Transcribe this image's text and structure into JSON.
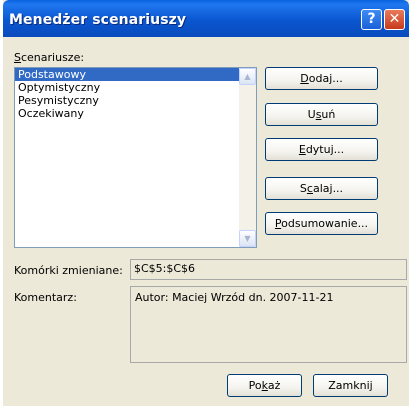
{
  "window": {
    "title": "Menedżer scenariuszy",
    "help_icon_glyph": "?",
    "close_icon_glyph": "✕"
  },
  "scenarios": {
    "label_key": "S",
    "label_rest": "cenariusze:",
    "items": [
      "Podstawowy",
      "Optymistyczny",
      "Pesymistyczny",
      "Oczekiwany"
    ],
    "selected_index": 0
  },
  "buttons": {
    "add": {
      "key": "D",
      "rest": "odaj..."
    },
    "delete": {
      "pre": "U",
      "key": "s",
      "rest": "uń"
    },
    "edit": {
      "key": "E",
      "rest": "dytuj..."
    },
    "merge": {
      "pre": "S",
      "key": "c",
      "rest": "alaj..."
    },
    "summary": {
      "key": "P",
      "rest": "odsumowanie..."
    },
    "show": {
      "pre": "Po",
      "key": "k",
      "rest": "aż"
    },
    "close": "Zamknij"
  },
  "changing_cells": {
    "label": "Komórki zmieniane:",
    "value": "$C$5:$C$6"
  },
  "comment": {
    "label": "Komentarz:",
    "value": "Autor: Maciej Wrzód dn. 2007-11-21"
  },
  "icons": {
    "scroll_up": "chevron-up-icon",
    "scroll_down": "chevron-down-icon"
  }
}
